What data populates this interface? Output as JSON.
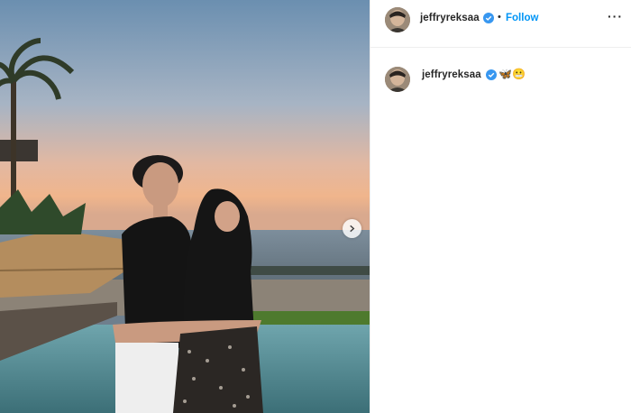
{
  "post": {
    "username": "jeffryreksaa",
    "follow_label": "Follow",
    "dot_separator": "•",
    "more_label": "···",
    "caption_emoji": "🦋😬",
    "photo_icons": {
      "next": "chevron-right-icon"
    }
  },
  "colors": {
    "link_blue": "#0095f6",
    "verified_blue": "#3897f0",
    "text": "#262626",
    "border": "#efefef"
  }
}
